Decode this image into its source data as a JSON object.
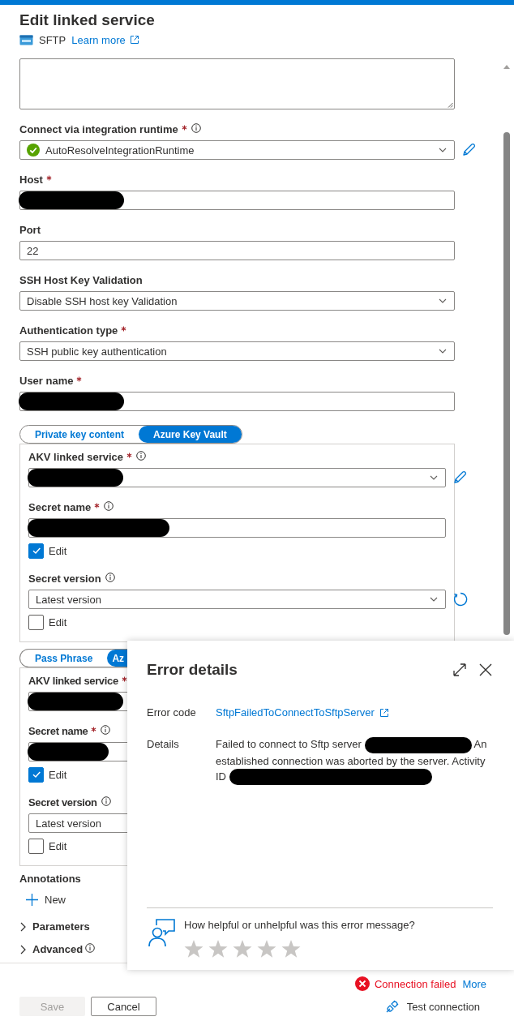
{
  "header": {
    "title": "Edit linked service",
    "connector": "SFTP",
    "learn_more": "Learn more"
  },
  "fields": [
    {
      "kind": "select",
      "label": "Connect via integration runtime",
      "required": true,
      "info": true,
      "value": "AutoResolveIntegrationRuntime",
      "ok": true,
      "editable": true
    },
    {
      "kind": "text",
      "label": "Host",
      "required": true,
      "redacted": true
    },
    {
      "kind": "text",
      "label": "Port",
      "value": "22"
    },
    {
      "kind": "select",
      "label": "SSH Host Key Validation",
      "value": "Disable SSH host key Validation"
    },
    {
      "kind": "select",
      "label": "Authentication type",
      "required": true,
      "value": "SSH public key authentication"
    },
    {
      "kind": "text",
      "label": "User name",
      "required": true,
      "redacted": true
    }
  ],
  "key_groups": [
    {
      "options": [
        {
          "label": "Private key content",
          "selected": false
        },
        {
          "label": "Azure Key Vault",
          "selected": true
        }
      ],
      "fields": [
        {
          "kind": "select",
          "label": "AKV linked service",
          "required": true,
          "info": true,
          "redacted": true,
          "editable": true
        },
        {
          "kind": "text",
          "label": "Secret name",
          "required": true,
          "info": true,
          "redacted": true,
          "edit": {
            "label": "Edit",
            "checked": true
          }
        },
        {
          "kind": "select",
          "label": "Secret version",
          "info": true,
          "value": "Latest version",
          "refreshable": true,
          "edit": {
            "label": "Edit",
            "checked": false
          }
        }
      ]
    },
    {
      "options": [
        {
          "label": "Pass Phrase",
          "selected": false
        },
        {
          "label": "Az",
          "selected": true
        }
      ],
      "fields": [
        {
          "kind": "select",
          "label": "AKV linked service",
          "required": true,
          "redacted": true
        },
        {
          "kind": "text",
          "label": "Secret name",
          "required": true,
          "info": true,
          "redacted": true,
          "edit": {
            "label": "Edit",
            "checked": true
          }
        },
        {
          "kind": "select",
          "label": "Secret version",
          "info": true,
          "value": "Latest version",
          "edit": {
            "label": "Edit",
            "checked": false
          }
        }
      ]
    }
  ],
  "annotations": {
    "title": "Annotations",
    "new": "New"
  },
  "sections": [
    {
      "label": "Parameters",
      "expanded": false
    },
    {
      "label": "Advanced",
      "expanded": false,
      "info": true
    }
  ],
  "error_panel": {
    "title": "Error details",
    "error_code_label": "Error code",
    "error_code": "SftpFailedToConnectToSftpServer",
    "details_label": "Details",
    "details": [
      {
        "kind": "text",
        "text": "Failed to connect to Sftp server"
      },
      {
        "kind": "redaction"
      },
      {
        "kind": "text",
        "text": "An established connection was aborted by the server. Activity ID"
      },
      {
        "kind": "redaction"
      }
    ],
    "feedback_question": "How helpful or unhelpful was this error message?",
    "stars": 0
  },
  "footer": {
    "status": "Connection failed",
    "more": "More",
    "save": {
      "label": "Save",
      "disabled": true
    },
    "cancel": "Cancel",
    "test": "Test connection"
  }
}
